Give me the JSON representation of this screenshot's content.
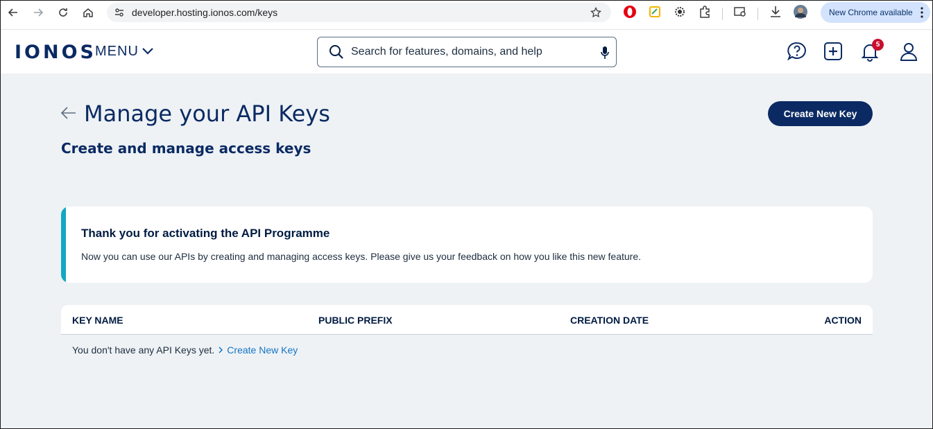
{
  "browser": {
    "url": "developer.hosting.ionos.com/keys",
    "new_chrome_label": "New Chrome available"
  },
  "header": {
    "logo": "IONOS",
    "menu_label": "MENU",
    "search_placeholder": "Search for features, domains, and help",
    "notification_count": "5"
  },
  "page": {
    "title": "Manage your API Keys",
    "subtitle": "Create and manage access keys",
    "create_button": "Create New Key"
  },
  "notice": {
    "title": "Thank you for activating the API Programme",
    "text": "Now you can use our APIs by creating and managing access keys. Please give us your feedback on how you like this new feature."
  },
  "table": {
    "columns": [
      "KEY NAME",
      "PUBLIC PREFIX",
      "CREATION DATE",
      "ACTION"
    ],
    "empty_text": "You don't have any API Keys yet.",
    "empty_link": "Create New Key"
  },
  "colors": {
    "brand": "#0b2a63",
    "accent": "#11a8c0",
    "link": "#1474c4",
    "badge": "#c8102e"
  }
}
